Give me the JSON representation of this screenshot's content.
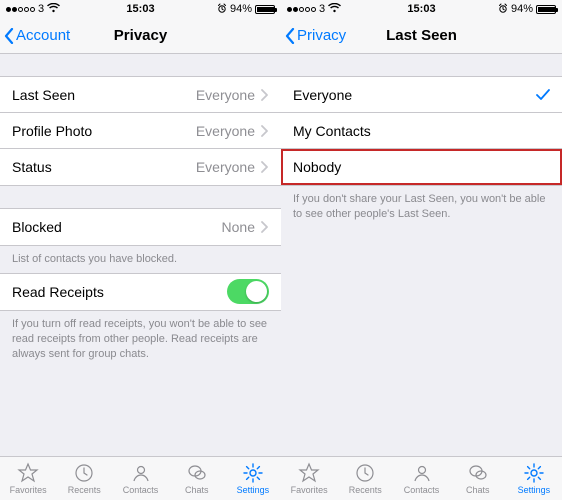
{
  "statusbar": {
    "carrier": "3",
    "wifi_glyph": "᯾",
    "time": "15:03",
    "battery_pct": "94%",
    "battery_fill_pct": 94,
    "alarm_glyph": "⏱"
  },
  "left": {
    "back_label": "Account",
    "title": "Privacy",
    "rows": {
      "lastseen": {
        "label": "Last Seen",
        "value": "Everyone"
      },
      "photo": {
        "label": "Profile Photo",
        "value": "Everyone"
      },
      "status": {
        "label": "Status",
        "value": "Everyone"
      }
    },
    "blocked": {
      "label": "Blocked",
      "value": "None"
    },
    "blocked_footer": "List of contacts you have blocked.",
    "readreceipts": {
      "label": "Read Receipts",
      "on": true
    },
    "readreceipts_footer": "If you turn off read receipts, you won't be able to see read receipts from other people. Read receipts are always sent for group chats."
  },
  "right": {
    "back_label": "Privacy",
    "title": "Last Seen",
    "options": {
      "everyone": "Everyone",
      "contacts": "My Contacts",
      "nobody": "Nobody"
    },
    "selected": "everyone",
    "footer": "If you don't share your Last Seen, you won't be able to see other people's Last Seen."
  },
  "tabs": {
    "favorites": "Favorites",
    "recents": "Recents",
    "contacts": "Contacts",
    "chats": "Chats",
    "settings": "Settings"
  }
}
